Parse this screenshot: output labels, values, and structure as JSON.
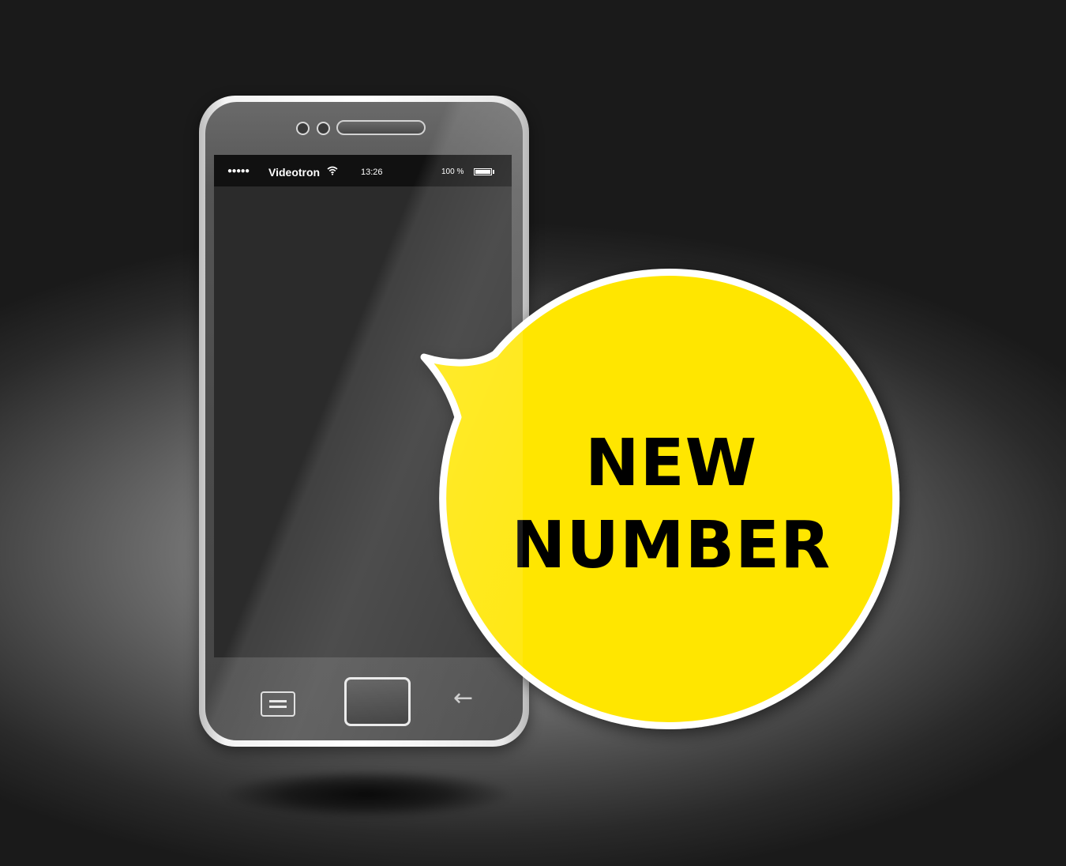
{
  "scene": {
    "background_color": "#1a1a1a",
    "accent_color": "#ffe600"
  },
  "phone": {
    "status_bar": {
      "signal_dots": "●●●●●",
      "carrier": "Videotron",
      "wifi_icon": "wifi-icon",
      "time": "13:26",
      "battery_percent": "100 %",
      "battery_icon": "battery-icon",
      "battery_level": 1.0
    },
    "buttons": {
      "menu_icon": "menu-icon",
      "home_icon": "home-button",
      "back_icon": "back-arrow-icon",
      "back_glyph": "←"
    }
  },
  "bubble": {
    "line1": "NEW",
    "line2": "NUMBER",
    "fill_color": "#ffe600",
    "stroke_color": "#ffffff"
  }
}
